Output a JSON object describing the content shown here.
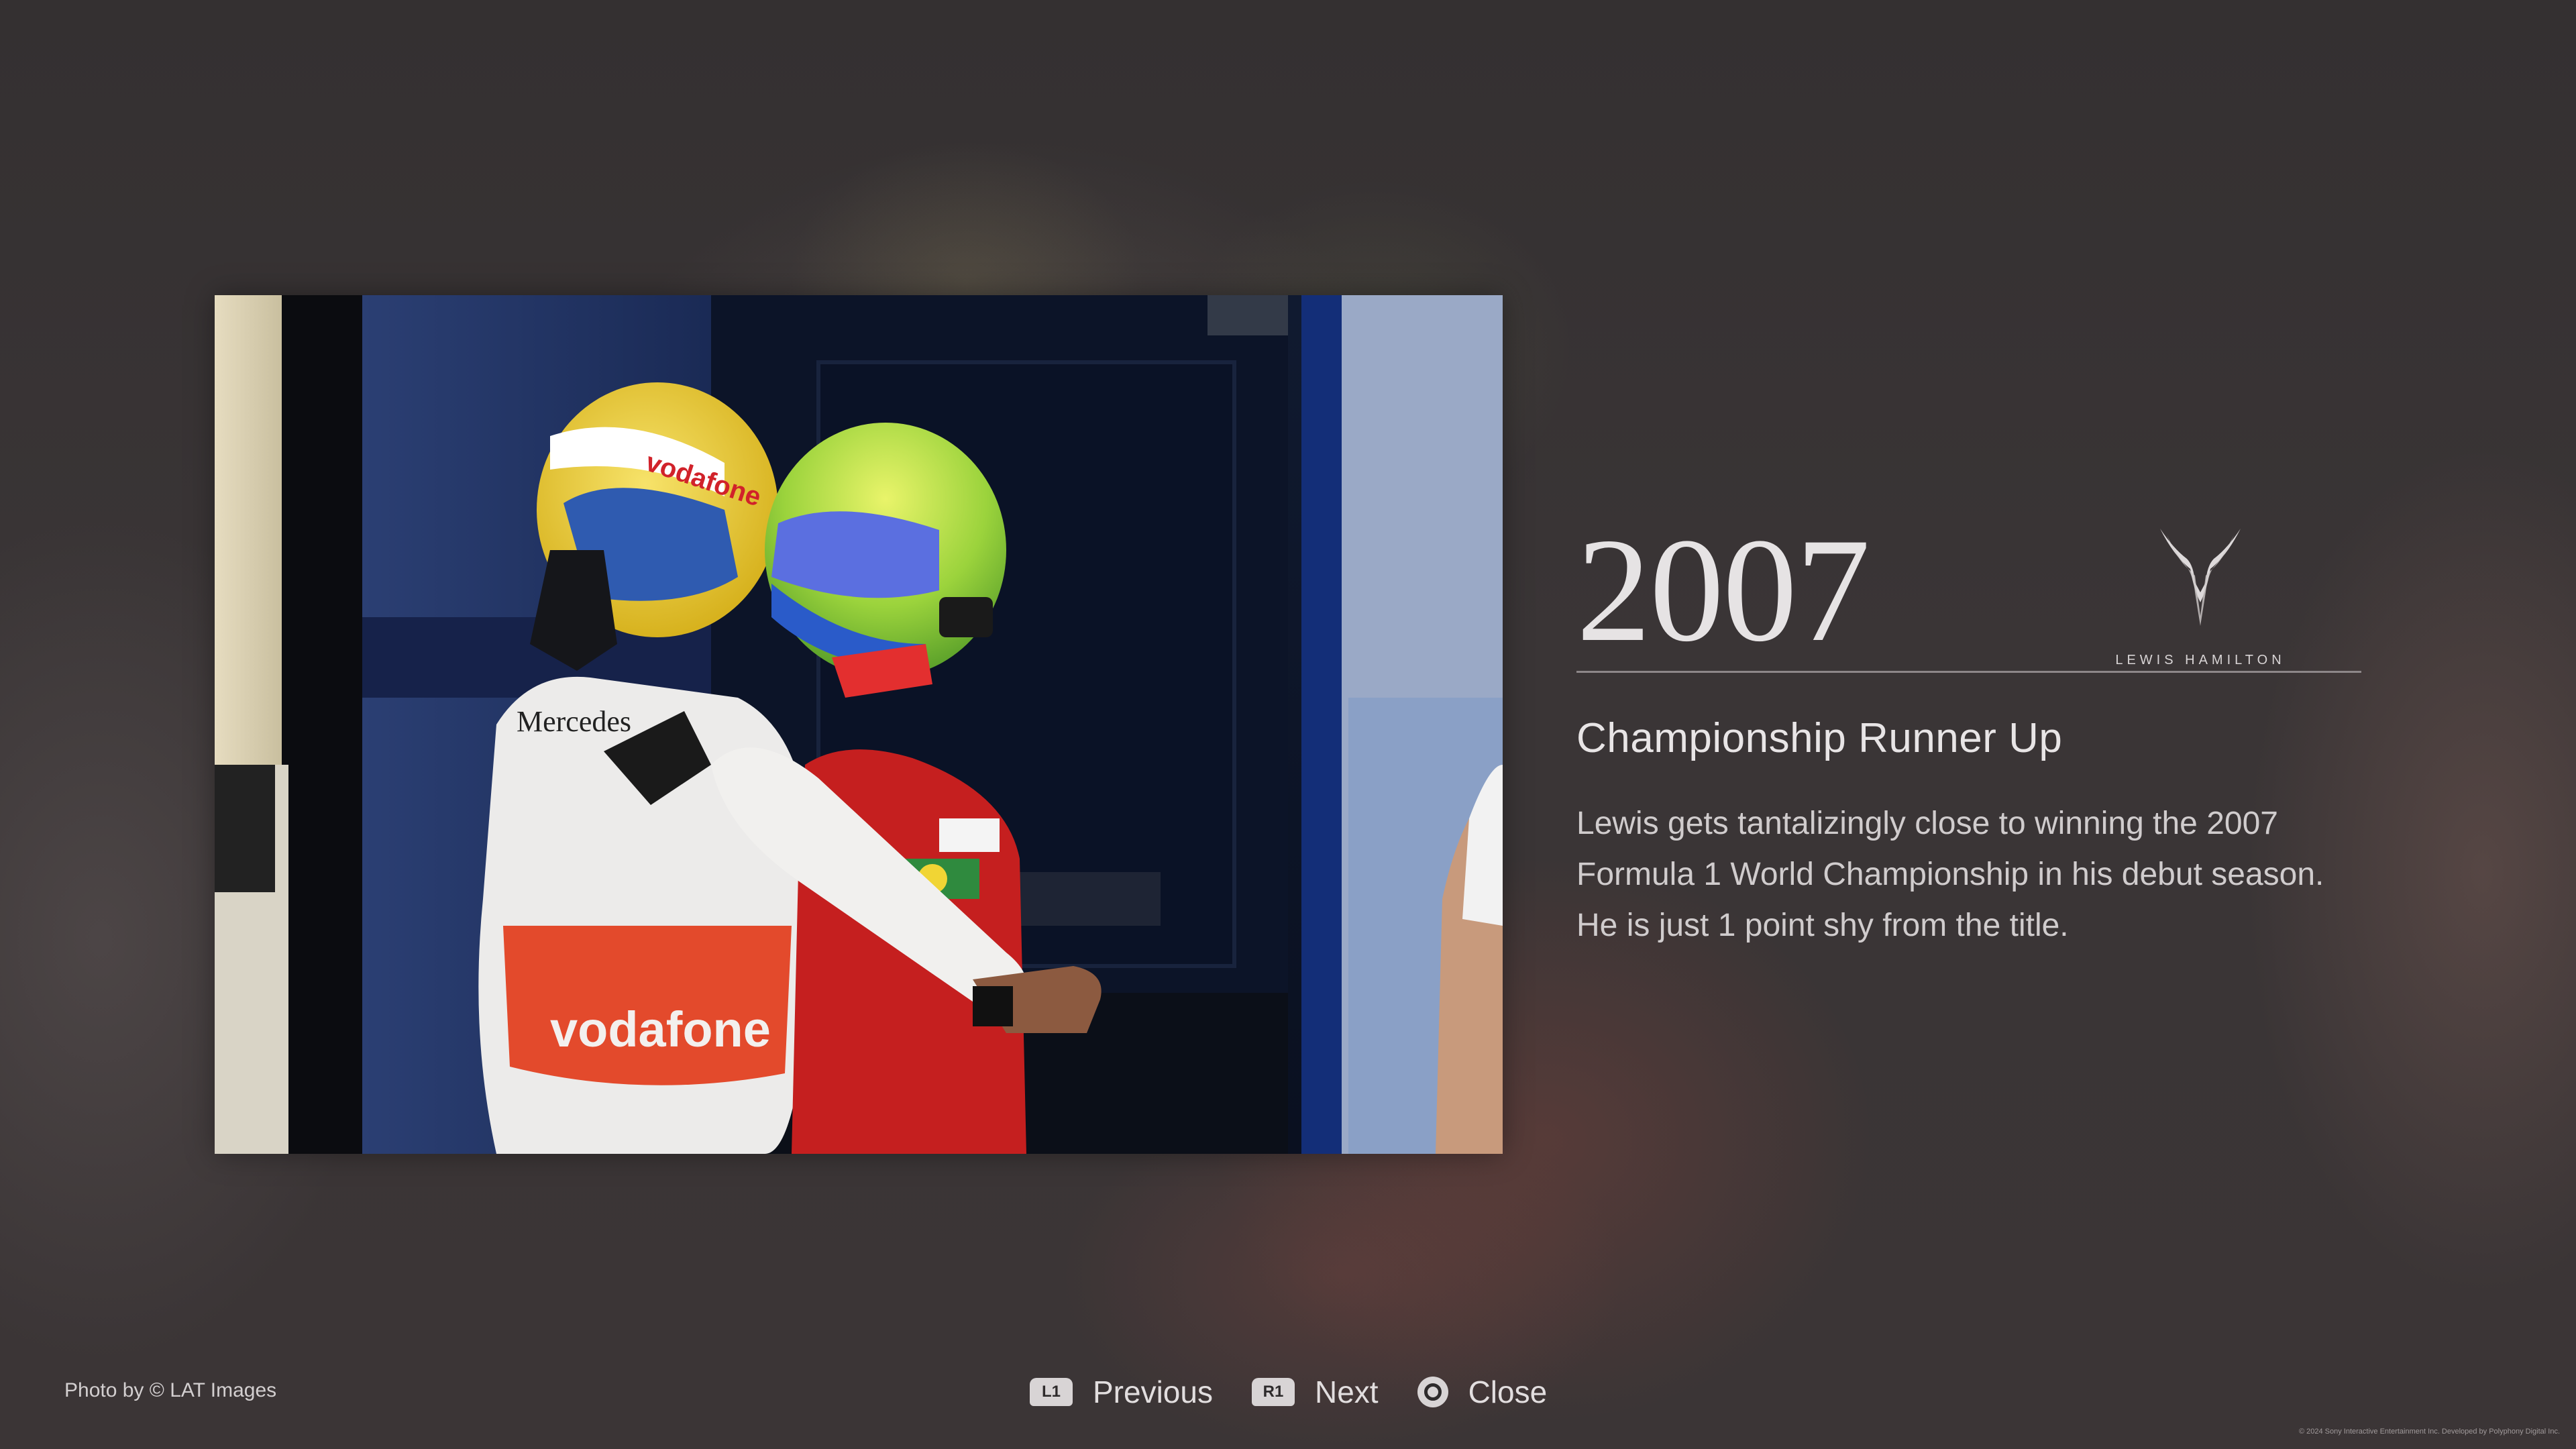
{
  "info": {
    "year": "2007",
    "logo_text": "LEWIS HAMILTON",
    "subtitle": "Championship Runner Up",
    "description": "Lewis gets tantalizingly close to winning the 2007 Formula 1 World Championship in his debut season. He is just 1 point shy from the title."
  },
  "footer": {
    "credit": "Photo by © LAT Images",
    "copyright": "© 2024 Sony Interactive Entertainment Inc. Developed by Polyphony Digital Inc."
  },
  "nav": {
    "previous": {
      "button": "L1",
      "label": "Previous"
    },
    "next": {
      "button": "R1",
      "label": "Next"
    },
    "close": {
      "button": "circle",
      "label": "Close"
    }
  },
  "photo": {
    "jersey_text": "vodafone",
    "suit_text": "Mercedes",
    "helmet_text": "vodafone"
  },
  "icons": {
    "logo": "lewis-hamilton-logo-icon",
    "close": "circle-button-icon"
  }
}
